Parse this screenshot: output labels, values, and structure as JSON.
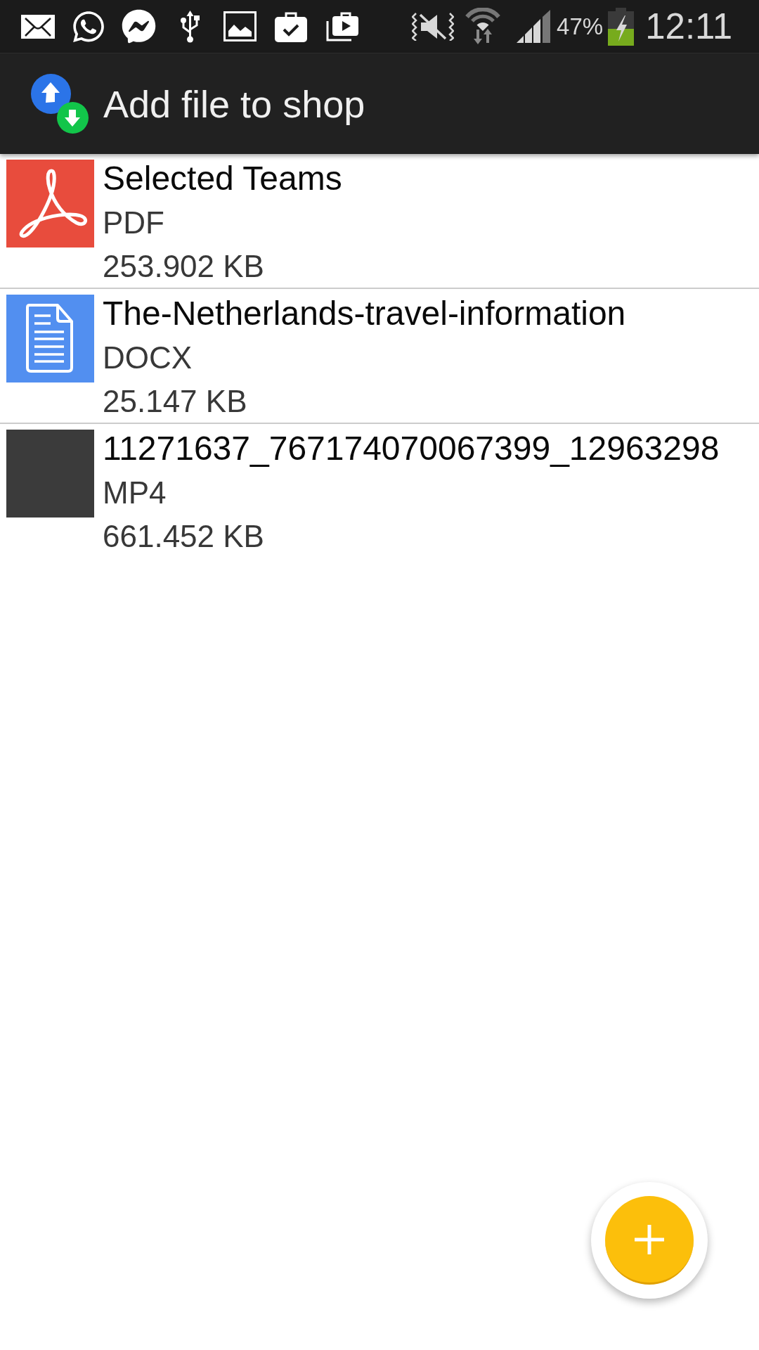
{
  "status_bar": {
    "battery_percent": "47%",
    "time": "12:11"
  },
  "app_bar": {
    "title": "Add file to shop"
  },
  "files": [
    {
      "kind": "pdf",
      "name": "Selected Teams",
      "type": "PDF",
      "size": "253.902 KB"
    },
    {
      "kind": "document",
      "name": "The-Netherlands-travel-information",
      "type": "DOCX",
      "size": "25.147 KB"
    },
    {
      "kind": "video",
      "name": "11271637_767174070067399_12963298",
      "type": "MP4",
      "size": "661.452 KB"
    }
  ]
}
